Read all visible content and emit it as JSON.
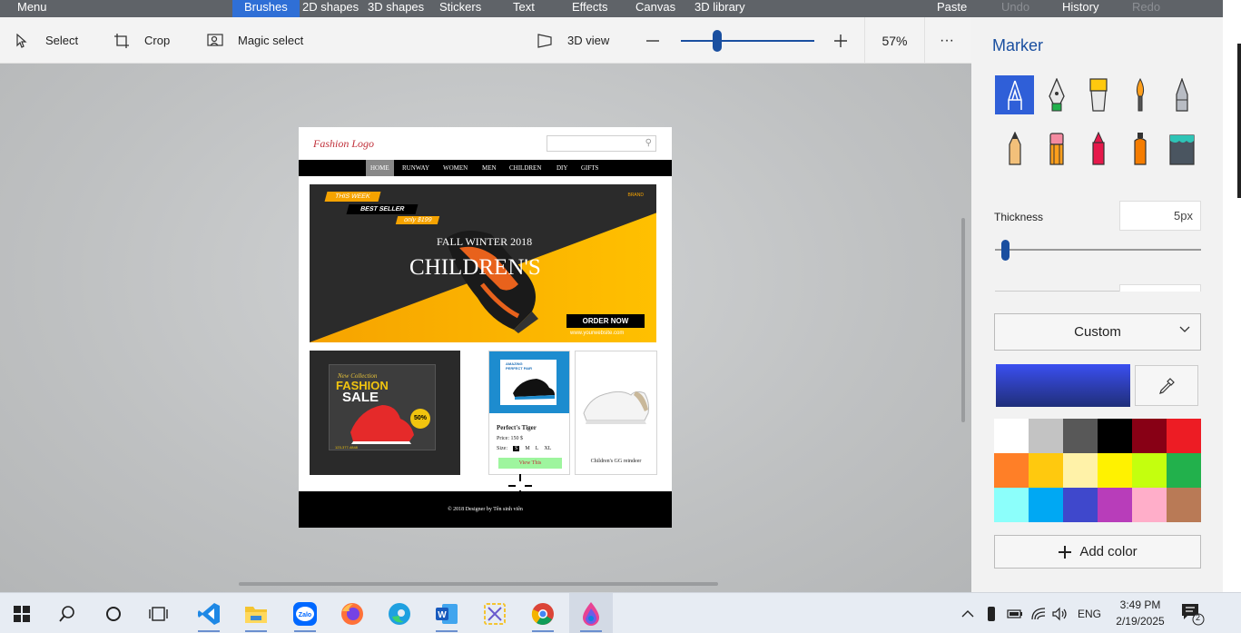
{
  "menubar": {
    "menu": "Menu",
    "tabs": [
      {
        "label": "Brushes",
        "active": true
      },
      {
        "label": "2D shapes"
      },
      {
        "label": "3D shapes"
      },
      {
        "label": "Stickers"
      },
      {
        "label": "Text"
      },
      {
        "label": "Effects"
      },
      {
        "label": "Canvas"
      },
      {
        "label": "3D library"
      }
    ],
    "paste": "Paste",
    "undo": "Undo",
    "history": "History",
    "redo": "Redo"
  },
  "toolbar": {
    "select": "Select",
    "crop": "Crop",
    "magic_select": "Magic select",
    "view3d": "3D view",
    "zoom": "57%",
    "more": "···"
  },
  "canvas": {
    "logo": "Fashion Logo",
    "nav": [
      "HOME",
      "RUNWAY",
      "WOMEN",
      "MEN",
      "CHILDREN",
      "DIY",
      "GIFTS"
    ],
    "banner": {
      "tag1": "THIS WEEK",
      "tag2": "BEST SELLER",
      "tag3": "only $199",
      "brand": "BRAND",
      "season": "FALL WINTER 2018",
      "headline": "CHILDREN'S",
      "order": "ORDER NOW",
      "website": "www.yourwebsite.com"
    },
    "promo": {
      "collection": "New Collection",
      "title1": "FASHION",
      "title2": "SALE",
      "badge": "50%",
      "phone": "123-377-4848"
    },
    "product1": {
      "img_text": "AMAZING PERFECT PAIR",
      "name": "Perfect's Tiger",
      "price": "Price: 150 $",
      "size_label": "Size:",
      "sizes": [
        "S",
        "M",
        "L",
        "XL"
      ],
      "button": "View This"
    },
    "product2": {
      "name": "Children's GG reindeer"
    },
    "footer": "© 2018 Designer by Tên sinh viên"
  },
  "panel": {
    "title": "Marker",
    "brushes": [
      "marker",
      "calligraphy-pen",
      "oil-brush",
      "watercolor",
      "pencil-fine",
      "pencil",
      "eraser",
      "crayon",
      "spray-can",
      "fill"
    ],
    "thickness_label": "Thickness",
    "thickness_value": "5px",
    "thickness_level": 0.03,
    "dropdown": "Custom",
    "selected_color": "#3340c8",
    "palette": [
      "#ffffff",
      "#c3c3c3",
      "#585858",
      "#000000",
      "#880015",
      "#ed1c24",
      "#ff7f27",
      "#ffc90e",
      "#fff2a8",
      "#fff200",
      "#c4ff0e",
      "#22b14c",
      "#8cfffb",
      "#00a8f3",
      "#3f48cc",
      "#b83dba",
      "#ffaec9",
      "#b97a56"
    ],
    "add_color": "Add color"
  },
  "taskbar": {
    "apps": [
      "start-icon",
      "search-icon",
      "cortana-icon",
      "task-view-icon",
      "vscode-icon",
      "file-explorer-icon",
      "zalo-icon",
      "firefox-icon",
      "edge-icon",
      "word-icon",
      "snipping-tool-icon",
      "chrome-icon",
      "paint3d-icon"
    ],
    "language": "ENG",
    "time": "3:49 PM",
    "date": "2/19/2025",
    "notifications": "2"
  }
}
